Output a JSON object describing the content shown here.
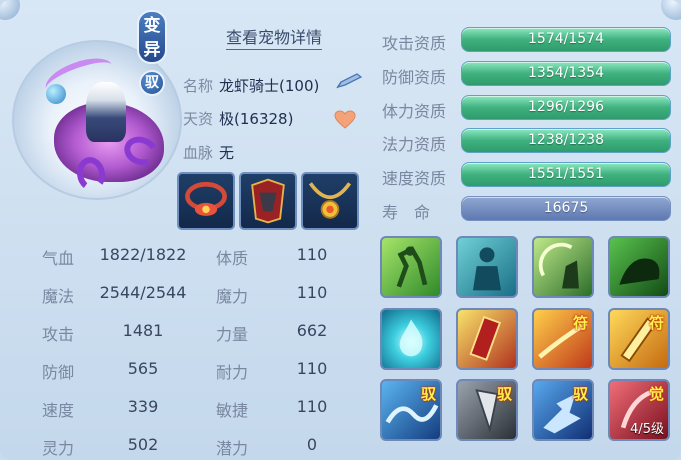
{
  "header": {
    "variant_badge": "变异",
    "ride_badge": "驭",
    "view_detail": "查看宠物详情"
  },
  "info": {
    "name_label": "名称",
    "name_value": "龙虾骑士(100)",
    "talent_label": "天资",
    "talent_value": "极(16328)",
    "bloodline_label": "血脉",
    "bloodline_value": "无"
  },
  "equipment": [
    {
      "icon": "necklace-red-icon"
    },
    {
      "icon": "armor-red-icon"
    },
    {
      "icon": "necklace-gold-icon"
    }
  ],
  "attributes": [
    {
      "label": "气血",
      "value": "1822/1822",
      "label2": "体质",
      "value2": "110"
    },
    {
      "label": "魔法",
      "value": "2544/2544",
      "label2": "魔力",
      "value2": "110"
    },
    {
      "label": "攻击",
      "value": "1481",
      "label2": "力量",
      "value2": "662"
    },
    {
      "label": "防御",
      "value": "565",
      "label2": "耐力",
      "value2": "110"
    },
    {
      "label": "速度",
      "value": "339",
      "label2": "敏捷",
      "value2": "110"
    },
    {
      "label": "灵力",
      "value": "502",
      "label2": "潜力",
      "value2": "0"
    }
  ],
  "aptitudes": [
    {
      "label": "攻击资质",
      "value": "1574/1574",
      "fill": 1.0
    },
    {
      "label": "防御资质",
      "value": "1354/1354",
      "fill": 1.0
    },
    {
      "label": "体力资质",
      "value": "1296/1296",
      "fill": 1.0
    },
    {
      "label": "法力资质",
      "value": "1238/1238",
      "fill": 1.0
    },
    {
      "label": "速度资质",
      "value": "1551/1551",
      "fill": 1.0
    },
    {
      "label": "寿　命",
      "value": "16675",
      "fill": 1.0
    }
  ],
  "skills": [
    {
      "icon": "green-warrior-skill-icon",
      "tag": "",
      "level": ""
    },
    {
      "icon": "blue-figure-skill-icon",
      "tag": "",
      "level": ""
    },
    {
      "icon": "moon-warrior-skill-icon",
      "tag": "",
      "level": ""
    },
    {
      "icon": "green-beast-skill-icon",
      "tag": "",
      "level": ""
    },
    {
      "icon": "blue-flame-skill-icon",
      "tag": "",
      "level": ""
    },
    {
      "icon": "scroll-seal-skill-icon",
      "tag": "",
      "level": ""
    },
    {
      "icon": "fire-slash-skill-icon",
      "tag": "符",
      "level": ""
    },
    {
      "icon": "gold-blade-skill-icon",
      "tag": "符",
      "level": ""
    },
    {
      "icon": "blue-wave-skill-icon",
      "tag": "驭",
      "level": ""
    },
    {
      "icon": "grey-fang-skill-icon",
      "tag": "驭",
      "level": ""
    },
    {
      "icon": "blue-dash-skill-icon",
      "tag": "驭",
      "level": ""
    },
    {
      "icon": "red-awaken-skill-icon",
      "tag": "觉",
      "level": "4/5级"
    }
  ],
  "colors": {
    "bar_green": "#3fb17f",
    "bar_blue": "#5e79b3",
    "panel_bg": "#c9dcee"
  }
}
